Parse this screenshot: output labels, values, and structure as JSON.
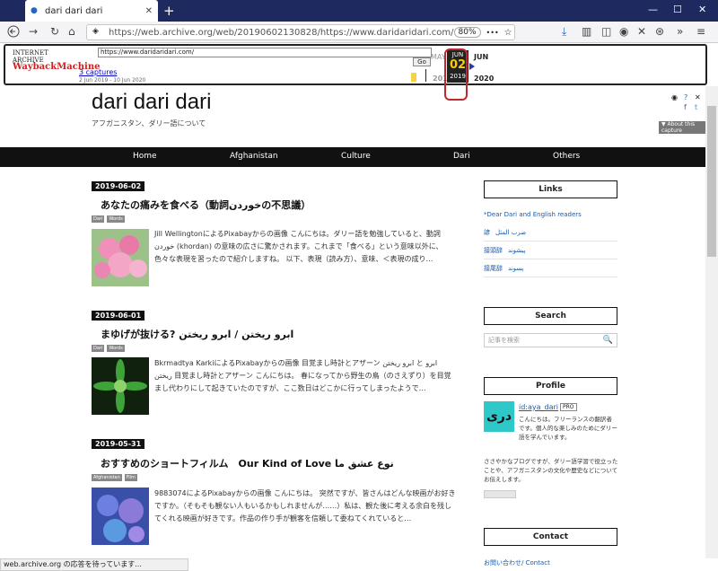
{
  "browser": {
    "tab_title": "dari dari dari",
    "tab_close": "✕",
    "new_tab": "+",
    "win_min": "—",
    "win_max": "☐",
    "win_close": "✕",
    "url": "https://web.archive.org/web/20190602130828/https://www.daridaridari.com/",
    "zoom": "80%",
    "more_dots": "•••",
    "status_text": "web.archive.org の応答を待っています..."
  },
  "wayback": {
    "logo_top": "INTERNET ARCHIVE",
    "logo_main": "WaybackMachine",
    "url_value": "https://www.daridaridari.com/",
    "go_label": "Go",
    "captures_link": "3 captures",
    "captures_range": "2 Jun 2019 - 10 Jun 2020",
    "prev_month": "MAY",
    "next_month": "JUN",
    "cal_month": "JUN",
    "cal_day": "02",
    "cal_year": "2019",
    "prev_year": "2018",
    "next_year": "2020",
    "about": "▼ About this capture"
  },
  "site": {
    "title": "dari dari dari",
    "description": "アフガニスタン、ダリー語について"
  },
  "menu": [
    "Home",
    "Afghanistan",
    "Culture",
    "Dari",
    "Others"
  ],
  "posts": [
    {
      "date": "2019-06-02",
      "title": "あなたの痛みを食べる（動詞خوردنの不思議）",
      "tags": [
        "Dari",
        "Words"
      ],
      "excerpt": "Jill WellingtonによるPixabayからの画像 こんにちは。ダリー語を勉強していると、動詞خوردن (khordan) の意味の広さに驚かされます。これまで「食べる」という意味以外に、色々な表現を習ったので紹介しますね。 以下、表現（読み方）、意味、＜表現の成り…"
    },
    {
      "date": "2019-06-01",
      "title": "まゆげが抜ける? ابرو ریختن / ابرو ریختن",
      "tags": [
        "Dari",
        "Words"
      ],
      "excerpt": "Bkrmadtya KarkiによるPixabayからの画像 目覚まし時計とアザーン ابرو ریختن と ابرو ریختن 目覚まし時計とアザーン こんにちは。 春になってから野生の鳥（のさえずり）を目覚まし代わりにして起きていたのですが、ここ数日はどこかに行ってしまったようで…"
    },
    {
      "date": "2019-05-31",
      "title": "おすすめのショートフィルム　Our Kind of Love نوع عشق ما",
      "tags": [
        "Afghanistan",
        "Film"
      ],
      "excerpt": "9883074によるPixabayからの画像 こんにちは。 突然ですが、皆さんはどんな映画がお好きですか。（そもそも観ない人もいるかもしれませんが……）私は、観た後に考える余白を残してくれる映画が好きです。作品の作り手が観客を信頼して委ねてくれていると…"
    }
  ],
  "sidebar": {
    "links_title": "Links",
    "links_intro": "*Dear Dari and English readers",
    "links": [
      {
        "ja": "諺",
        "fa": "ضرب المثل"
      },
      {
        "ja": "接頭辞",
        "fa": "پیشوند"
      },
      {
        "ja": "接尾辞",
        "fa": "پسوند"
      }
    ],
    "search_title": "Search",
    "search_placeholder": "記事を検索",
    "search_icon": "🔍",
    "profile_title": "Profile",
    "avatar_text": "دری",
    "profile_name": "id:aya_dari",
    "profile_badge": "PRO",
    "profile_text": "こんにちは。フリーランスの翻訳者です。個人的な楽しみのためにダリー語を学んでいます。",
    "profile_text2": "ささやかなブログですが、ダリー語学習で役立ったことや、アフガニスタンの文化や歴史などについてお伝えします。",
    "contact_title": "Contact",
    "contact_link": "お問い合わせ/ Contact"
  }
}
